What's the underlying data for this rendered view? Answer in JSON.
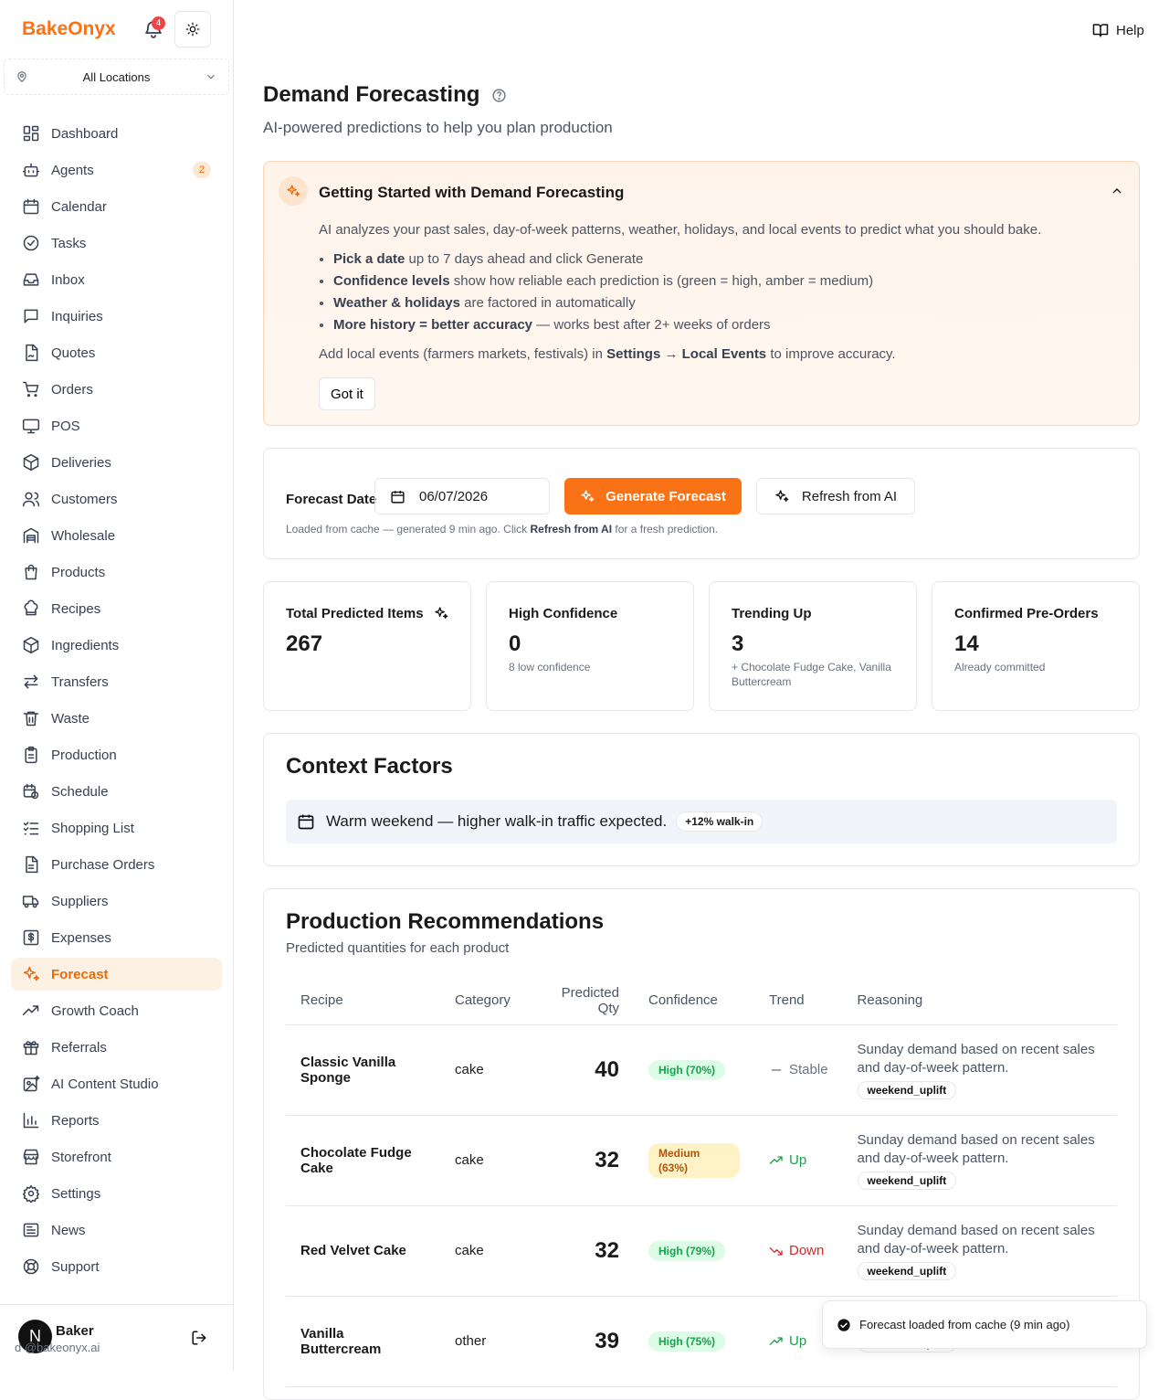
{
  "sidebar": {
    "brand": "BakeOnyx",
    "notification_count": "4",
    "location": "All Locations",
    "items": [
      {
        "label": "Dashboard",
        "icon": "dashboard-icon"
      },
      {
        "label": "Agents",
        "icon": "bot-icon",
        "badge": "2"
      },
      {
        "label": "Calendar",
        "icon": "calendar-icon"
      },
      {
        "label": "Tasks",
        "icon": "check-circle-icon"
      },
      {
        "label": "Inbox",
        "icon": "inbox-icon"
      },
      {
        "label": "Inquiries",
        "icon": "message-icon"
      },
      {
        "label": "Quotes",
        "icon": "file-signature-icon"
      },
      {
        "label": "Orders",
        "icon": "cart-icon"
      },
      {
        "label": "POS",
        "icon": "monitor-icon"
      },
      {
        "label": "Deliveries",
        "icon": "package-icon"
      },
      {
        "label": "Customers",
        "icon": "users-icon"
      },
      {
        "label": "Wholesale",
        "icon": "warehouse-icon"
      },
      {
        "label": "Products",
        "icon": "shopping-bag-icon"
      },
      {
        "label": "Recipes",
        "icon": "chef-hat-icon"
      },
      {
        "label": "Ingredients",
        "icon": "box-icon"
      },
      {
        "label": "Transfers",
        "icon": "arrows-icon"
      },
      {
        "label": "Waste",
        "icon": "trash-icon"
      },
      {
        "label": "Production",
        "icon": "clipboard-icon"
      },
      {
        "label": "Schedule",
        "icon": "calendar-clock-icon"
      },
      {
        "label": "Shopping List",
        "icon": "list-checks-icon"
      },
      {
        "label": "Purchase Orders",
        "icon": "file-text-icon"
      },
      {
        "label": "Suppliers",
        "icon": "truck-icon"
      },
      {
        "label": "Expenses",
        "icon": "dollar-icon"
      },
      {
        "label": "Forecast",
        "icon": "sparkles-icon",
        "active": true
      },
      {
        "label": "Growth Coach",
        "icon": "trending-up-icon"
      },
      {
        "label": "Referrals",
        "icon": "gift-icon"
      },
      {
        "label": "AI Content Studio",
        "icon": "image-sparkle-icon"
      },
      {
        "label": "Reports",
        "icon": "bar-chart-icon"
      },
      {
        "label": "Storefront",
        "icon": "store-icon"
      },
      {
        "label": "Settings",
        "icon": "gear-icon"
      },
      {
        "label": "News",
        "icon": "newspaper-icon"
      },
      {
        "label": "Support",
        "icon": "life-buoy-icon"
      }
    ],
    "user": {
      "avatar_letter": "N",
      "name": "Baker",
      "email": "d     @bakeonyx.ai"
    }
  },
  "header": {
    "help_label": "Help"
  },
  "page": {
    "title": "Demand Forecasting",
    "subtitle": "AI-powered predictions to help you plan production"
  },
  "getting_started": {
    "title": "Getting Started with Demand Forecasting",
    "intro": "AI analyzes your past sales, day-of-week patterns, weather, holidays, and local events to predict what you should bake.",
    "tips": [
      {
        "bold": "Pick a date",
        "text": " up to 7 days ahead and click Generate"
      },
      {
        "bold": "Confidence levels",
        "text": " show how reliable each prediction is (green = high, amber = medium)"
      },
      {
        "bold": "Weather & holidays",
        "text": " are factored in automatically"
      },
      {
        "bold": "More history = better accuracy",
        "text": " — works best after 2+ weeks of orders"
      }
    ],
    "footer_pre": "Add local events (farmers markets, festivals) in ",
    "footer_bold": "Settings → Local Events",
    "footer_post": " to improve accuracy.",
    "got_it_label": "Got it"
  },
  "forecast_date": {
    "label": "Forecast Date",
    "value": "06/07/2026",
    "generate_label": "Generate Forecast",
    "refresh_label": "Refresh from AI",
    "note_pre": "Loaded from cache — generated 9 min ago. Click ",
    "note_bold": "Refresh from AI",
    "note_post": " for a fresh prediction."
  },
  "stats": [
    {
      "title": "Total Predicted Items",
      "value": "267",
      "sub": ""
    },
    {
      "title": "High Confidence",
      "value": "0",
      "sub": "8 low confidence"
    },
    {
      "title": "Trending Up",
      "value": "3",
      "sub": "+ Chocolate Fudge Cake, Vanilla Buttercream"
    },
    {
      "title": "Confirmed Pre-Orders",
      "value": "14",
      "sub": "Already committed"
    }
  ],
  "context": {
    "title": "Context Factors",
    "factor_text": "Warm weekend — higher walk-in traffic expected.",
    "factor_badge": "+12% walk-in"
  },
  "recommendations": {
    "title": "Production Recommendations",
    "subtitle": "Predicted quantities for each product",
    "columns": [
      "Recipe",
      "Category",
      "Predicted Qty",
      "Confidence",
      "Trend",
      "Reasoning"
    ],
    "rows": [
      {
        "recipe": "Classic Vanilla Sponge",
        "category": "cake",
        "qty": "40",
        "confidence": "High (70%)",
        "level": "high",
        "trend": "Stable",
        "trend_dir": "stable",
        "reasoning": "Sunday demand based on recent sales and day-of-week pattern.",
        "tag": "weekend_uplift"
      },
      {
        "recipe": "Chocolate Fudge Cake",
        "category": "cake",
        "qty": "32",
        "confidence": "Medium (63%)",
        "level": "med",
        "trend": "Up",
        "trend_dir": "up",
        "reasoning": "Sunday demand based on recent sales and day-of-week pattern.",
        "tag": "weekend_uplift"
      },
      {
        "recipe": "Red Velvet Cake",
        "category": "cake",
        "qty": "32",
        "confidence": "High (79%)",
        "level": "high",
        "trend": "Down",
        "trend_dir": "down",
        "reasoning": "Sunday demand based on recent sales and day-of-week pattern.",
        "tag": "weekend_uplift"
      },
      {
        "recipe": "Vanilla Buttercream",
        "category": "other",
        "qty": "39",
        "confidence": "High (75%)",
        "level": "high",
        "trend": "Up",
        "trend_dir": "up",
        "reasoning": "",
        "tag": "weekend_uplift"
      }
    ]
  },
  "toast": {
    "message": "Forecast loaded from cache (9 min ago)"
  }
}
